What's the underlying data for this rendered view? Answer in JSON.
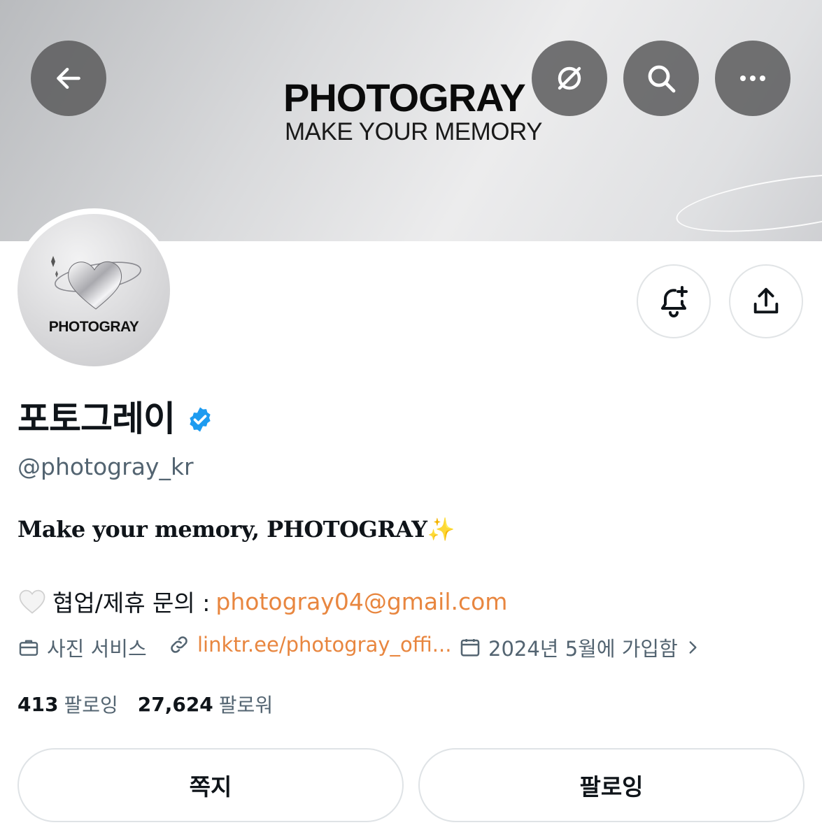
{
  "banner": {
    "logo_text": "PHOTOGRAY",
    "tagline": "MAKE YOUR MEMORY"
  },
  "top_actions": {
    "back_icon": "arrow-left-icon",
    "grok_icon": "grok-icon",
    "search_icon": "search-icon",
    "more_icon": "more-horizontal-icon"
  },
  "avatar": {
    "text": "PHOTOGRAY"
  },
  "profile_actions": {
    "notify_icon": "bell-plus-icon",
    "share_icon": "share-icon"
  },
  "profile": {
    "display_name": "포토그레이",
    "verified": true,
    "handle": "@photogray_kr",
    "bio_line1": "Make your memory, PHOTOGRAY",
    "bio_line1_emoji": "✨",
    "bio_line2_prefix": "협업/제휴 문의 : ",
    "bio_line2_email": "photogray04@gmail.com"
  },
  "meta": {
    "category": "사진 서비스",
    "link": "linktr.ee/photogray_offi...",
    "joined": "2024년 5월에 가입함"
  },
  "stats": {
    "following_count": "413",
    "following_label": "팔로잉",
    "followers_count": "27,624",
    "followers_label": "팔로워"
  },
  "buttons": {
    "message_label": "쪽지",
    "following_label": "팔로잉"
  },
  "colors": {
    "link": "#e8863f",
    "verified": "#1d9bf0",
    "secondary_text": "#536471"
  }
}
